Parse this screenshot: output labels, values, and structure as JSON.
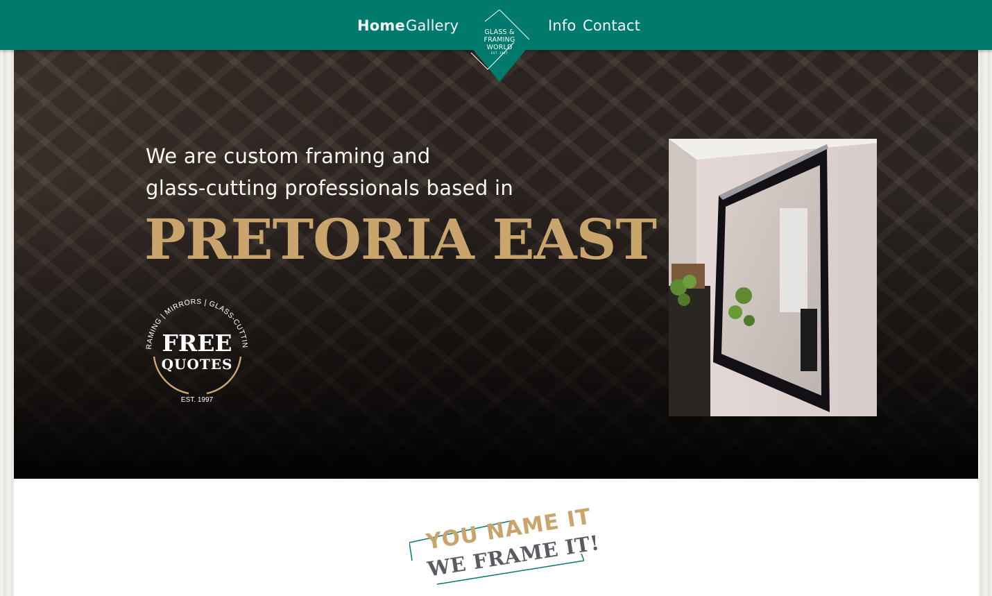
{
  "nav": {
    "items": [
      {
        "label": "Home",
        "active": true
      },
      {
        "label": "Gallery"
      },
      {
        "label": "Info"
      },
      {
        "label": "Contact"
      }
    ],
    "logo": {
      "line1": "GLASS &",
      "line2": "FRAMING",
      "line3": "WORLD",
      "est": "EST. 1997"
    }
  },
  "hero": {
    "intro_line1": "We are custom framing and",
    "intro_line2": "glass-cutting professionals based in",
    "place": "PRETORIA EAST",
    "badge": {
      "arc_text": "FRAMING | MIRRORS | GLASS-CUTTING",
      "line1": "FREE",
      "line2": "QUOTES",
      "est": "EST. 1997"
    },
    "photo_alt": "framed-mirror-photo"
  },
  "tagline": {
    "line1": "YOU NAME IT",
    "line2": "WE FRAME IT!"
  },
  "colors": {
    "brand_green": "#007a6d",
    "gold": "#c9a46c",
    "dark_bg": "#2b2320",
    "text_light": "#fbf7f1"
  }
}
